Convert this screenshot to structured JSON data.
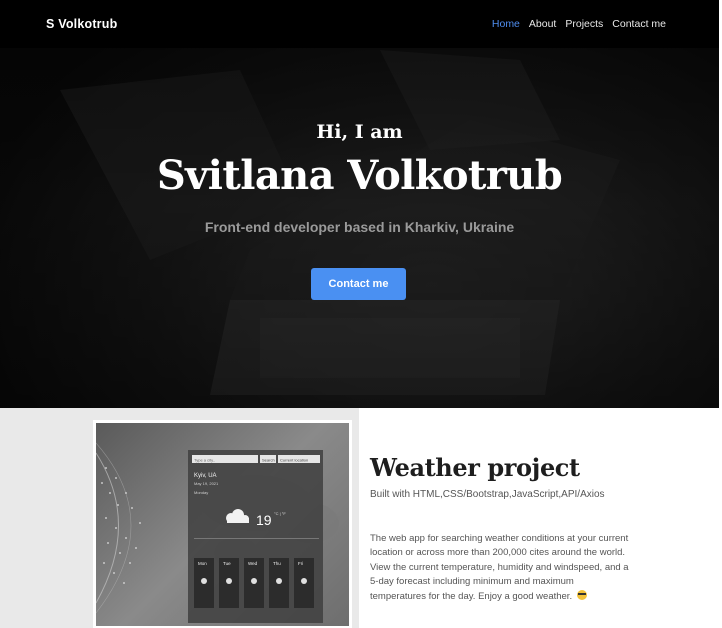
{
  "nav": {
    "brand": "S Volkotrub",
    "links": [
      "Home",
      "About",
      "Projects",
      "Contact me"
    ],
    "active_link": "Home"
  },
  "hero": {
    "greeting": "Hi, I am",
    "name": "Svitlana Volkotrub",
    "tagline": "Front-end developer based in Kharkiv, Ukraine",
    "cta_label": "Contact me"
  },
  "project": {
    "title": "Weather project",
    "tech": "Built with HTML,CSS/Bootstrap,JavaScript,API/Axios",
    "description": "The web app for searching weather conditions at your current location or across more than 200,000 cites around the world. View the current temperature, humidity and windspeed, and a 5-day forecast including minimum and maximum temperatures for the day. Enjoy a good weather.",
    "screenshot": {
      "search_placeholder": "Type a city..",
      "search_button": "Search",
      "location_button": "Current location",
      "city": "Kyiv, UA",
      "date": "May 19, 2021",
      "weekday": "Monday",
      "temperature": "19",
      "unit": "°C | °F",
      "forecast_days": [
        "Mon",
        "Tue",
        "Wed",
        "Thu",
        "Fri"
      ]
    }
  },
  "colors": {
    "accent": "#4a90f2",
    "active_nav": "#4f8ef0",
    "nav_bg": "#000000",
    "hero_bg": "#141414"
  }
}
